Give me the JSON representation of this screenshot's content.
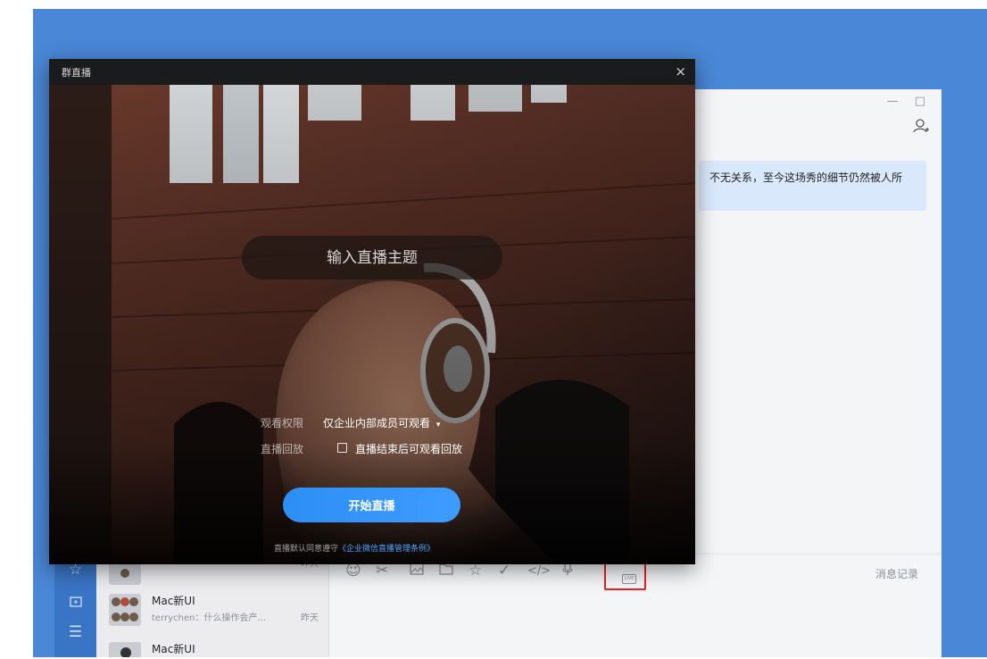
{
  "app": {
    "window_controls": {
      "minimize": "—",
      "maximize": "□"
    },
    "chat_bubble_text": "不无关系，至今这场秀的细节仍然被人所",
    "conversations": [
      {
        "name": "…",
        "preview": "",
        "time": "昨天"
      },
      {
        "name": "Mac新UI",
        "preview": "terrychen：什么操作会产…",
        "time": "昨天"
      },
      {
        "name": "Mac新UI",
        "preview": "",
        "time": ""
      }
    ],
    "toolbar": {
      "tools": [
        "emoji-icon",
        "scissors-icon",
        "image-icon",
        "folder-icon",
        "star-icon",
        "check-icon",
        "code-icon",
        "microphone-icon",
        "live-icon"
      ],
      "live_label": "LIVE",
      "history_label": "消息记录"
    }
  },
  "dialog": {
    "title": "群直播",
    "close_glyph": "×",
    "topic_placeholder": "输入直播主题",
    "permission_label": "观看权限",
    "permission_value": "仅企业内部成员可观看",
    "permission_caret": "▾",
    "replay_label": "直播回放",
    "replay_option": "直播结束后可观看回放",
    "replay_checked": false,
    "start_button": "开始直播",
    "terms_prefix": "直播默认同意遵守",
    "terms_link": "《企业微信直播管理条例》"
  },
  "colors": {
    "desktop": "#4a87d6",
    "nav_rail": "#3a74c5",
    "primary_button": "#2d8ef4",
    "highlight": "#e62020"
  }
}
